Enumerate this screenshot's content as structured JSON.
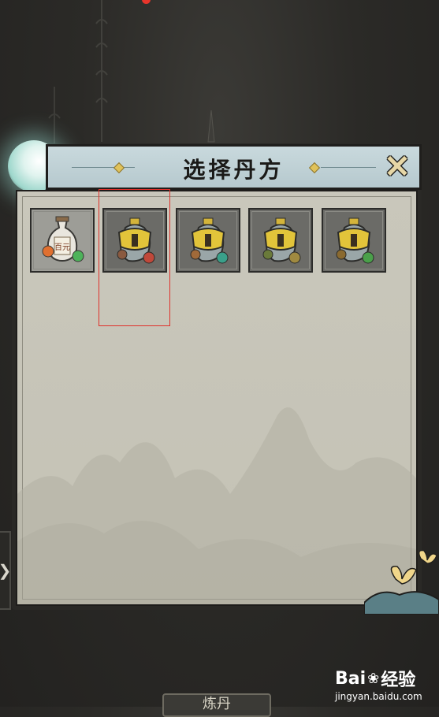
{
  "dialog": {
    "title": "选择丹方",
    "close_icon": "close-x-icon"
  },
  "slots": [
    {
      "name": "elixir-bottle-icon",
      "label": "百元",
      "locked": false,
      "orb_colors": [
        "#e07030",
        "#4db35a"
      ]
    },
    {
      "name": "locked-recipe-icon",
      "locked": true,
      "orb_colors": [
        "#8a5a40",
        "#c0483a"
      ]
    },
    {
      "name": "locked-recipe-icon",
      "locked": true,
      "orb_colors": [
        "#a06a3a",
        "#3aa08a"
      ]
    },
    {
      "name": "locked-recipe-icon",
      "locked": true,
      "orb_colors": [
        "#6a7a3a",
        "#a08a40"
      ]
    },
    {
      "name": "locked-recipe-icon",
      "locked": true,
      "orb_colors": [
        "#8a6a30",
        "#4aa04a"
      ]
    }
  ],
  "bottom_button": {
    "label": "炼丹"
  },
  "watermark": {
    "brand_prefix": "Bai",
    "brand_suffix": "经验",
    "site": "jingyan.baidu.com"
  },
  "colors": {
    "highlight": "#e0312b",
    "panel_bg": "#c6c4b8",
    "header_bg": "#bfd0d4"
  }
}
